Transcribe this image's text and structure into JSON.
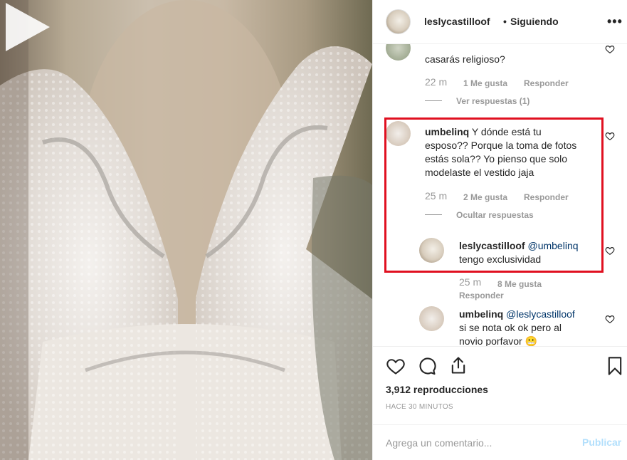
{
  "header": {
    "username": "leslycastilloof",
    "dot": "•",
    "follow_label": "Siguiendo",
    "more_label": "•••"
  },
  "comments": [
    {
      "text": "casarás religioso?",
      "time": "22 m",
      "likes": "1 Me gusta",
      "reply": "Responder",
      "replies_toggle": "Ver respuestas (1)"
    },
    {
      "username": "umbelinq",
      "lines": [
        "Y dónde está tu",
        "esposo?? Porque la toma de fotos",
        "estás sola?? Yo pienso que solo",
        "modelaste el vestido jaja"
      ],
      "time": "25 m",
      "likes": "2 Me gusta",
      "reply": "Responder",
      "replies_toggle": "Ocultar respuestas"
    },
    {
      "username": "leslycastilloof",
      "mention": "@umbelinq",
      "text": "tengo exclusividad",
      "time": "25 m",
      "likes": "8 Me gusta",
      "reply": "Responder"
    },
    {
      "username": "umbelinq",
      "mention": "@leslycastilloof",
      "lines": [
        "si se nota ok ok pero al",
        "novio porfavor 😬"
      ]
    }
  ],
  "actions": {
    "icons": [
      "heart-icon",
      "comment-icon",
      "share-icon",
      "bookmark-icon"
    ],
    "views": "3,912 reproducciones",
    "posted": "HACE 30 MINUTOS"
  },
  "add_comment": {
    "placeholder": "Agrega un comentario...",
    "publish_label": "Publicar"
  },
  "colors": {
    "highlight_border": "#e01020",
    "publish_disabled": "#b2dffc",
    "mention": "#003569",
    "muted": "#999999"
  }
}
